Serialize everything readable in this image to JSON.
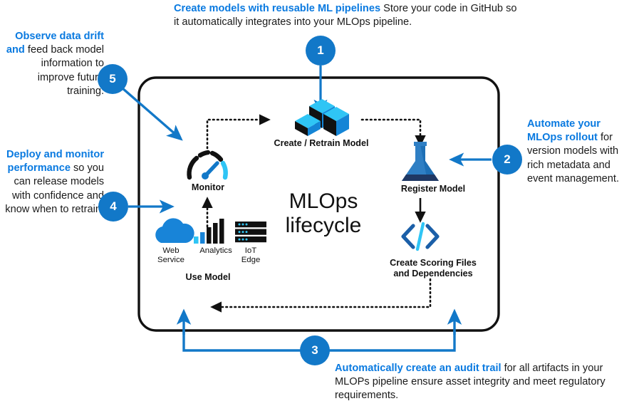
{
  "diagram": {
    "title": "MLOps lifecycle",
    "title_line1": "MLOps",
    "title_line2": "lifecycle",
    "accent_blue": "#1278c8",
    "link_blue": "#0a7ae0",
    "cyan": "#2fc5f5",
    "deep_blue": "#1b5fa8",
    "black": "#111111"
  },
  "callouts": [
    {
      "id": "1",
      "number": "1",
      "bold": "Create models with reusable ML pipelines",
      "rest": " Store your code in GitHub so it automatically integrates into your MLOps pipeline."
    },
    {
      "id": "2",
      "number": "2",
      "bold": "Automate your MLOps rollout",
      "rest": " for version models with rich metadata and event management."
    },
    {
      "id": "3",
      "number": "3",
      "bold": "Automatically create an audit trail",
      "rest": " for all artifacts in your MLOPs pipeline ensure asset integrity and meet regulatory requirements."
    },
    {
      "id": "4",
      "number": "4",
      "bold": "Deploy and monitor performance",
      "rest": " so you can release models with confidence and know when to retrain."
    },
    {
      "id": "5",
      "number": "5",
      "bold": "Observe data drift and",
      "rest": " feed back model information to improve future training."
    }
  ],
  "nodes": [
    {
      "id": "create",
      "label": "Create / Retrain Model",
      "icon": "cubes-icon"
    },
    {
      "id": "register",
      "label": "Register Model",
      "icon": "flask-icon"
    },
    {
      "id": "scoring",
      "label": "Create Scoring Files and Dependencies",
      "label_line1": "Create Scoring Files",
      "label_line2": "and Dependencies",
      "icon": "code-brackets-icon"
    },
    {
      "id": "usemodel",
      "label": "Use Model",
      "icon": "use-model-group"
    },
    {
      "id": "monitor",
      "label": "Monitor",
      "icon": "gauge-icon"
    }
  ],
  "use_model_icons": [
    {
      "id": "web",
      "label": "Web Service",
      "line1": "Web",
      "line2": "Service",
      "icon": "cloud-icon"
    },
    {
      "id": "analytics",
      "label": "Analytics",
      "line1": "Analytics",
      "line2": "",
      "icon": "bar-chart-icon"
    },
    {
      "id": "iot",
      "label": "IoT Edge",
      "line1": "IoT",
      "line2": "Edge",
      "icon": "server-rack-icon"
    }
  ]
}
